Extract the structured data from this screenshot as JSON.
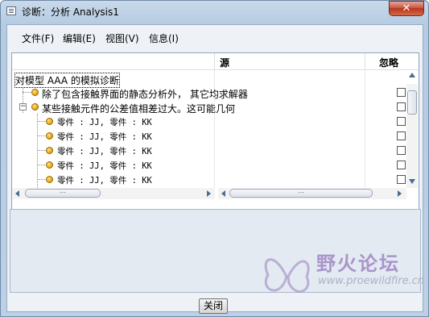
{
  "window": {
    "title": "诊断：分析 Analysis1",
    "close_glyph": "✕"
  },
  "menu": [
    {
      "label": "文件(F)"
    },
    {
      "label": "编辑(E)"
    },
    {
      "label": "视图(V)"
    },
    {
      "label": "信息(I)"
    }
  ],
  "tree": {
    "columns": {
      "source": "源",
      "ignore": "忽略"
    },
    "root_label": "对模型 AAA 的模拟诊断",
    "rows": [
      {
        "label": "除了包含接触界面的静态分析外， 其它均求解器"
      },
      {
        "label": "某些接触元件的公差值相差过大。这可能几何"
      },
      {
        "label": "零件 : JJ, 零件 : KK"
      },
      {
        "label": "零件 : JJ, 零件 : KK"
      },
      {
        "label": "零件 : JJ, 零件 : KK"
      },
      {
        "label": "零件 : JJ, 零件 : KK"
      },
      {
        "label": "零件 : JJ, 零件 : KK"
      }
    ],
    "ignore_checked": [
      false,
      false,
      false,
      false,
      false,
      false,
      false
    ]
  },
  "footer": {
    "close_label": "关闭"
  },
  "watermark": {
    "text": "野火论坛",
    "url": "www.proewildfire.cn"
  },
  "colors": {
    "title_bar": "#c9d9ea",
    "close_button": "#c75b42",
    "status_dot": "#e2a30b"
  }
}
